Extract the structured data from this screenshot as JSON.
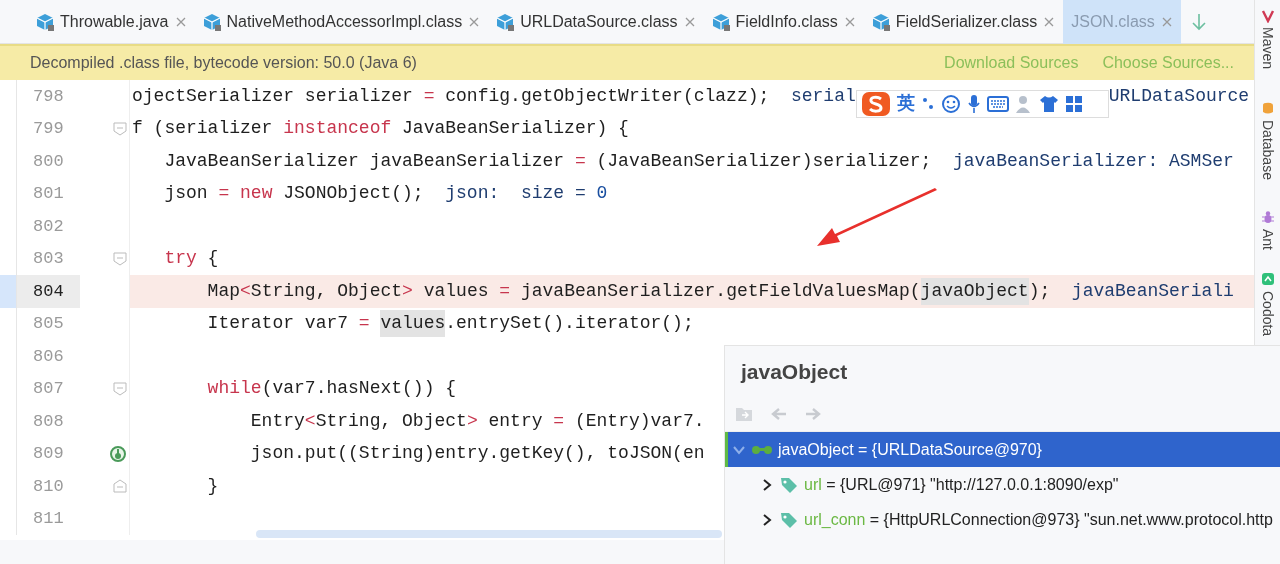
{
  "tabs": [
    {
      "label": "Throwable.java",
      "kind": "java",
      "selected": false
    },
    {
      "label": "NativeMethodAccessorImpl.class",
      "kind": "class",
      "selected": false
    },
    {
      "label": "URLDataSource.class",
      "kind": "class",
      "selected": false
    },
    {
      "label": "FieldInfo.class",
      "kind": "class",
      "selected": false
    },
    {
      "label": "FieldSerializer.class",
      "kind": "class",
      "selected": false
    },
    {
      "label": "JSON.class",
      "kind": "library",
      "selected": true
    }
  ],
  "banner": {
    "text": "Decompiled .class file, bytecode version: 50.0 (Java 6)",
    "links": [
      "Download Sources",
      "Choose Sources..."
    ]
  },
  "ime_bar": {
    "label": "英"
  },
  "editor": {
    "lines": [
      {
        "number": "798",
        "current": false,
        "breakpoint": false,
        "fold_start": false,
        "fold_end": false,
        "tokens": [
          {
            "text": "ojectSerializer serializer ",
            "kind": "plain"
          },
          {
            "text": "=",
            "kind": "op"
          },
          {
            "text": " config.getObjectWriter(clazz);  ",
            "kind": "plain"
          },
          {
            "text": "serial",
            "kind": "hint"
          },
          {
            "kind": "ime-bar"
          },
          {
            "text": "URLDataSource",
            "kind": "hint"
          }
        ]
      },
      {
        "number": "799",
        "current": false,
        "breakpoint": false,
        "fold_start": true,
        "fold_end": false,
        "tokens": [
          {
            "text": "f (serializer ",
            "kind": "plain"
          },
          {
            "text": "instanceof",
            "kind": "keyword"
          },
          {
            "text": " JavaBeanSerializer) {",
            "kind": "plain"
          }
        ]
      },
      {
        "number": "800",
        "current": false,
        "breakpoint": false,
        "fold_start": false,
        "fold_end": false,
        "tokens": [
          {
            "text": "   JavaBeanSerializer javaBeanSerializer ",
            "kind": "plain"
          },
          {
            "text": "=",
            "kind": "op"
          },
          {
            "text": " (JavaBeanSerializer)serializer;  ",
            "kind": "plain"
          },
          {
            "text": "javaBeanSerializer: ASMSer",
            "kind": "hint"
          }
        ]
      },
      {
        "number": "801",
        "current": false,
        "breakpoint": false,
        "fold_start": false,
        "fold_end": false,
        "tokens": [
          {
            "text": "   json ",
            "kind": "plain"
          },
          {
            "text": "= ",
            "kind": "op"
          },
          {
            "text": "new",
            "kind": "keyword"
          },
          {
            "text": " JSONObject();  ",
            "kind": "plain"
          },
          {
            "text": "json:  size = ",
            "kind": "hint"
          },
          {
            "text": "0",
            "kind": "number"
          }
        ]
      },
      {
        "number": "802",
        "current": false,
        "breakpoint": false,
        "fold_start": false,
        "fold_end": false
      },
      {
        "number": "803",
        "current": false,
        "breakpoint": false,
        "fold_start": true,
        "fold_end": false,
        "tokens": [
          {
            "text": "   try",
            "kind": "keyword"
          },
          {
            "text": " {",
            "kind": "plain"
          }
        ]
      },
      {
        "number": "804",
        "current": true,
        "breakpoint": false,
        "fold_start": false,
        "fold_end": false,
        "tokens": [
          {
            "text": "       Map",
            "kind": "plain"
          },
          {
            "text": "<",
            "kind": "op"
          },
          {
            "text": "String, Object",
            "kind": "plain"
          },
          {
            "text": ">",
            "kind": "op"
          },
          {
            "text": " values ",
            "kind": "plain"
          },
          {
            "text": "=",
            "kind": "op"
          },
          {
            "text": " javaBeanSerializer.getFieldValuesMap(",
            "kind": "plain"
          },
          {
            "text": "javaObject",
            "kind": "usage"
          },
          {
            "text": ");  ",
            "kind": "plain"
          },
          {
            "text": "javaBeanSeriali",
            "kind": "hint"
          }
        ]
      },
      {
        "number": "805",
        "current": false,
        "breakpoint": false,
        "fold_start": false,
        "fold_end": false,
        "tokens": [
          {
            "text": "       Iterator var7 ",
            "kind": "plain"
          },
          {
            "text": "= ",
            "kind": "op"
          },
          {
            "text": "values",
            "kind": "usage"
          },
          {
            "text": ".entrySet().iterator();",
            "kind": "plain"
          }
        ]
      },
      {
        "number": "806",
        "current": false,
        "breakpoint": false,
        "fold_start": false,
        "fold_end": false
      },
      {
        "number": "807",
        "current": false,
        "breakpoint": false,
        "fold_start": true,
        "fold_end": false,
        "tokens": [
          {
            "text": "       while",
            "kind": "keyword"
          },
          {
            "text": "(var7.hasNext()) {",
            "kind": "plain"
          }
        ]
      },
      {
        "number": "808",
        "current": false,
        "breakpoint": false,
        "fold_start": false,
        "fold_end": false,
        "tokens": [
          {
            "text": "           Entry",
            "kind": "plain"
          },
          {
            "text": "<",
            "kind": "op"
          },
          {
            "text": "String, Object",
            "kind": "plain"
          },
          {
            "text": ">",
            "kind": "op"
          },
          {
            "text": " entry ",
            "kind": "plain"
          },
          {
            "text": "=",
            "kind": "op"
          },
          {
            "text": " (Entry)var7.",
            "kind": "plain"
          }
        ]
      },
      {
        "number": "809",
        "current": false,
        "breakpoint": true,
        "fold_start": false,
        "fold_end": false,
        "tokens": [
          {
            "text": "           json.put((String)entry.getKey(), toJSON(en",
            "kind": "plain"
          }
        ]
      },
      {
        "number": "810",
        "current": false,
        "breakpoint": false,
        "fold_start": false,
        "fold_end": true,
        "tokens": [
          {
            "text": "       }",
            "kind": "plain"
          }
        ]
      },
      {
        "number": "811",
        "current": false,
        "breakpoint": false,
        "fold_start": false,
        "fold_end": false
      }
    ]
  },
  "popup": {
    "title": "javaObject",
    "tree": [
      {
        "name": "javaObject",
        "value": "= {URLDataSource@970}",
        "kind": "watch",
        "expanded": true,
        "selected": true,
        "children": [
          {
            "name": "url",
            "value": "= {URL@971} \"http://127.0.0.1:8090/exp\"",
            "kind": "field",
            "expanded": false,
            "selected": false
          },
          {
            "name": "url_conn",
            "value": "= {HttpURLConnection@973} \"sun.net.www.protocol.http",
            "kind": "field",
            "expanded": false,
            "selected": false
          }
        ]
      }
    ]
  },
  "sidebar": [
    {
      "label": "Maven",
      "kind": "maven"
    },
    {
      "label": "Database",
      "kind": "database"
    },
    {
      "label": "Ant",
      "kind": "ant"
    },
    {
      "label": "Codota",
      "kind": "codota"
    }
  ]
}
